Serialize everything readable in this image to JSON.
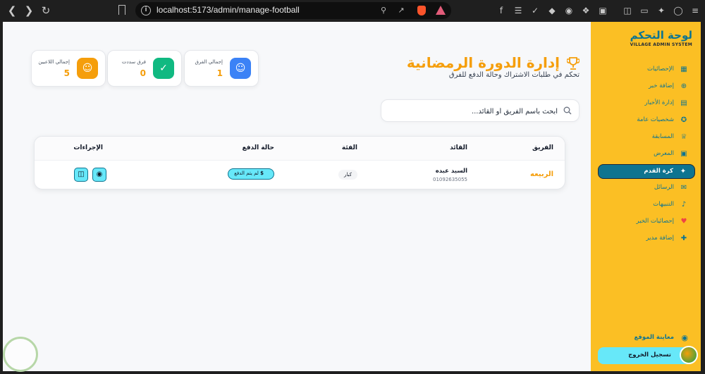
{
  "browser": {
    "url": "localhost:5173/admin/manage-football"
  },
  "sidebar": {
    "title": "لوحة التحكم",
    "subtitle": "VILLAGE ADMIN SYSTEM",
    "items": [
      {
        "label": "الإحصائيات",
        "icon": "grid-icon"
      },
      {
        "label": "إضافة خبر",
        "icon": "plus-circle-icon"
      },
      {
        "label": "إدارة الأخبار",
        "icon": "newspaper-icon"
      },
      {
        "label": "شخصيات عامة",
        "icon": "award-icon"
      },
      {
        "label": "المسابقة",
        "icon": "trophy-icon"
      },
      {
        "label": "المعرض",
        "icon": "image-icon"
      },
      {
        "label": "كرة القدم",
        "icon": "medal-icon"
      },
      {
        "label": "الرسائل",
        "icon": "message-icon"
      },
      {
        "label": "التنبيهات",
        "icon": "bell-icon"
      },
      {
        "label": "إحصائيات الخير",
        "icon": "heart-icon"
      },
      {
        "label": "إضافة مدير",
        "icon": "user-plus-icon"
      }
    ],
    "active_index": 6,
    "view_site": "معاينة الموقع",
    "logout": "تسجيل الخروج"
  },
  "header": {
    "title": "إدارة الدورة الرمضانية",
    "subtitle": "تحكم في طلبات الاشتراك وحالة الدفع للفرق"
  },
  "stats": [
    {
      "label": "إجمالي الفرق",
      "value": "1",
      "color": "#3b82f6",
      "icon": "users-icon"
    },
    {
      "label": "فرق سددت",
      "value": "0",
      "color": "#10b981",
      "icon": "check-circle-icon"
    },
    {
      "label": "إجمالي اللاعبين",
      "value": "5",
      "color": "#f59e0b",
      "icon": "users-icon"
    }
  ],
  "search": {
    "placeholder": "ابحث باسم الفريق أو القائد..."
  },
  "table": {
    "headers": {
      "team": "الفريق",
      "leader": "القائد",
      "category": "الفئة",
      "payment": "حالة الدفع",
      "actions": "الإجراءات"
    },
    "rows": [
      {
        "team": "الربيعه",
        "leader": "السيد عبده",
        "phone": "01092635055",
        "category": "كبار",
        "payment": "لم يتم الدفع",
        "payment_symbol": "$"
      }
    ]
  }
}
